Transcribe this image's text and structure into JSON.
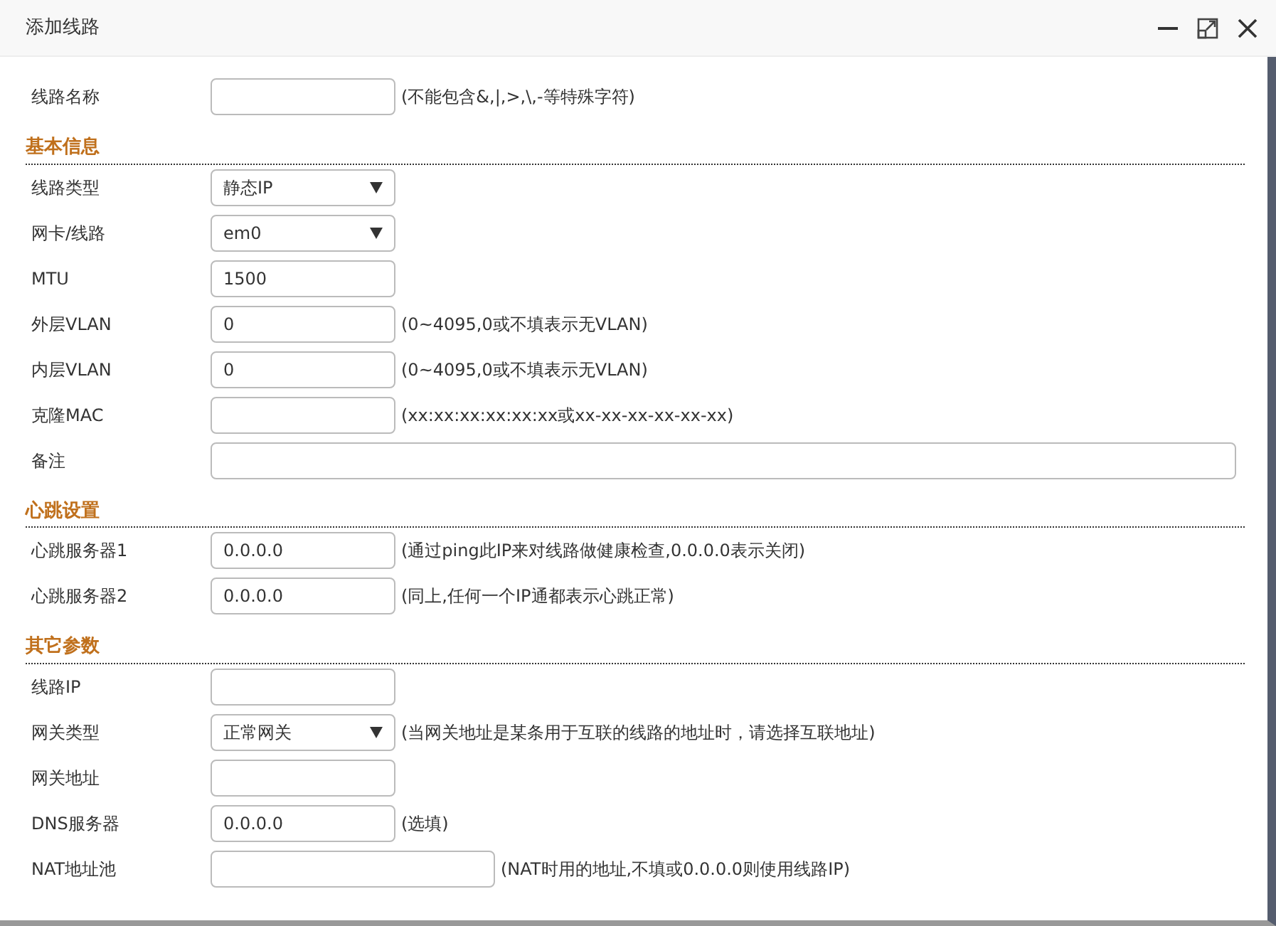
{
  "window": {
    "title": "添加线路"
  },
  "top_fields": [
    {
      "label": "线路名称",
      "kind": "text",
      "hint": "(不能包含&,|,>,\\,-等特殊字符)"
    }
  ],
  "sections": [
    {
      "title": "基本信息",
      "fields": [
        {
          "label": "线路类型",
          "kind": "select",
          "value": "静态IP"
        },
        {
          "label": "网卡/线路",
          "kind": "select",
          "value": "em0"
        },
        {
          "label": "MTU",
          "kind": "text",
          "value": "1500"
        },
        {
          "label": "外层VLAN",
          "kind": "text",
          "value": "0",
          "hint": "(0~4095,0或不填表示无VLAN)"
        },
        {
          "label": "内层VLAN",
          "kind": "text",
          "value": "0",
          "hint": "(0~4095,0或不填表示无VLAN)"
        },
        {
          "label": "克隆MAC",
          "kind": "text",
          "hint": "(xx:xx:xx:xx:xx:xx或xx-xx-xx-xx-xx-xx)"
        },
        {
          "label": "备注",
          "kind": "wide"
        }
      ]
    },
    {
      "title": "心跳设置",
      "fields": [
        {
          "label": "心跳服务器1",
          "kind": "text",
          "value": "0.0.0.0",
          "hint": "(通过ping此IP来对线路做健康检查,0.0.0.0表示关闭)"
        },
        {
          "label": "心跳服务器2",
          "kind": "text",
          "value": "0.0.0.0",
          "hint": "(同上,任何一个IP通都表示心跳正常)"
        }
      ]
    },
    {
      "title": "其它参数",
      "fields": [
        {
          "label": "线路IP",
          "kind": "text"
        },
        {
          "label": "网关类型",
          "kind": "select",
          "value": "正常网关",
          "hint": "(当网关地址是某条用于互联的线路的地址时，请选择互联地址)"
        },
        {
          "label": "网关地址",
          "kind": "text"
        },
        {
          "label": "DNS服务器",
          "kind": "text",
          "value": "0.0.0.0",
          "hint": "(选填)"
        },
        {
          "label": "NAT地址池",
          "kind": "long",
          "hint": "(NAT时用的地址,不填或0.0.0.0则使用线路IP)"
        }
      ]
    }
  ]
}
